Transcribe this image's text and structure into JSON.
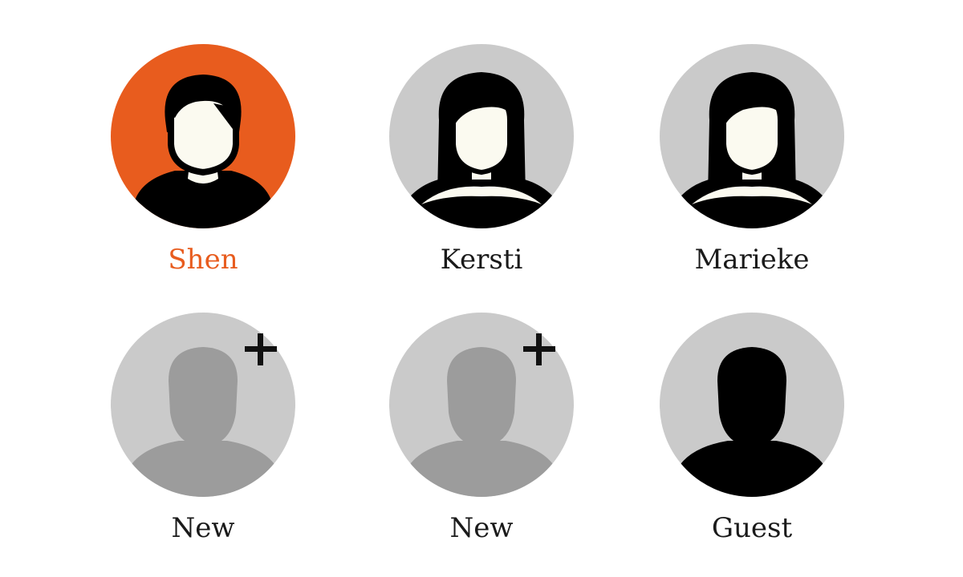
{
  "profiles": [
    {
      "name": "Shen",
      "kind": "male",
      "selected": true,
      "add": false,
      "icon": "user-avatar-icon"
    },
    {
      "name": "Kersti",
      "kind": "female",
      "selected": false,
      "add": false,
      "icon": "user-avatar-icon"
    },
    {
      "name": "Marieke",
      "kind": "female",
      "selected": false,
      "add": false,
      "icon": "user-avatar-icon"
    },
    {
      "name": "New",
      "kind": "new",
      "selected": false,
      "add": true,
      "icon": "add-user-icon"
    },
    {
      "name": "New",
      "kind": "new",
      "selected": false,
      "add": true,
      "icon": "add-user-icon"
    },
    {
      "name": "Guest",
      "kind": "guest",
      "selected": false,
      "add": false,
      "icon": "guest-avatar-icon"
    }
  ],
  "colors": {
    "accent": "#e85c1e",
    "circle_default": "#cacaca",
    "silhouette_placeholder": "#9c9c9c",
    "face": "#fbfaf0",
    "hair": "#000000",
    "text": "#1a1a1a"
  }
}
